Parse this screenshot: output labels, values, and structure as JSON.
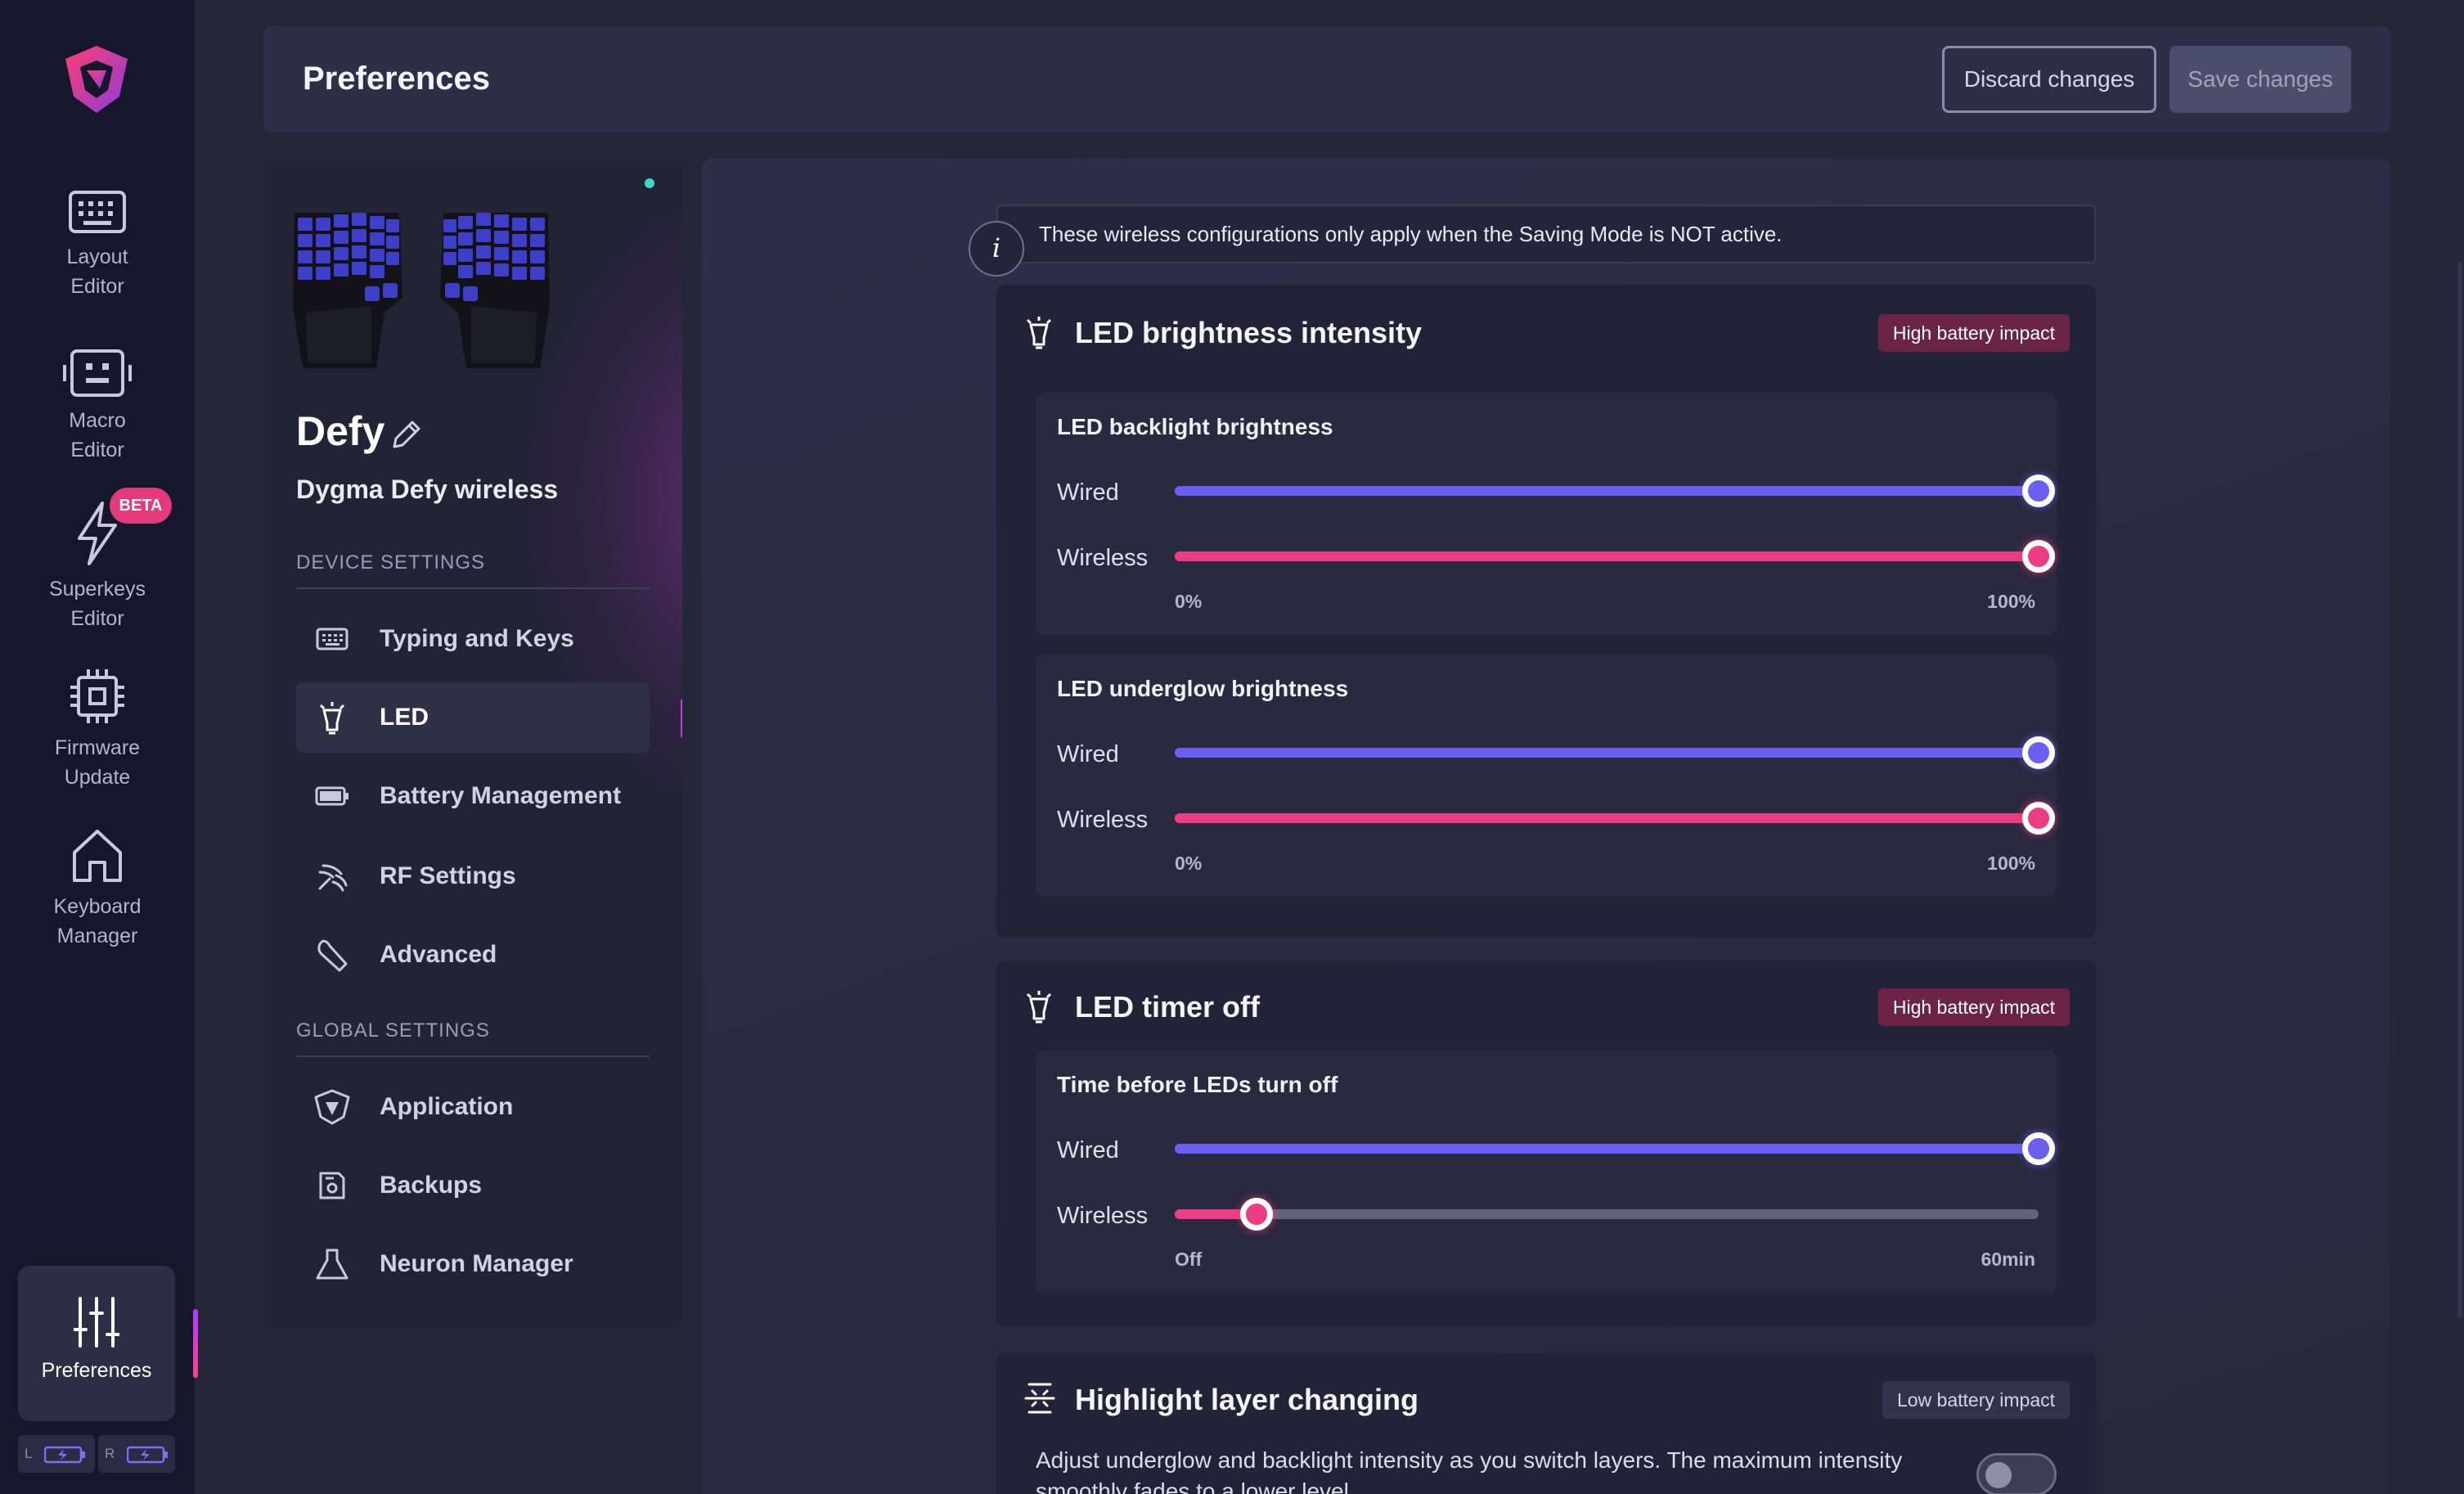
{
  "header": {
    "title": "Preferences",
    "discard_label": "Discard changes",
    "save_label": "Save changes"
  },
  "rail": {
    "items": [
      {
        "label_1": "Layout",
        "label_2": "Editor",
        "icon": "keyboard-icon"
      },
      {
        "label_1": "Macro",
        "label_2": "Editor",
        "icon": "macro-icon"
      },
      {
        "label_1": "Superkeys",
        "label_2": "Editor",
        "icon": "lightning-icon",
        "badge": "BETA"
      },
      {
        "label_1": "Firmware",
        "label_2": "Update",
        "icon": "chip-icon"
      },
      {
        "label_1": "Keyboard",
        "label_2": "Manager",
        "icon": "home-icon"
      }
    ],
    "preferences_label": "Preferences",
    "battery_left": "L",
    "battery_right": "R"
  },
  "device": {
    "name": "Defy",
    "model": "Dygma Defy wireless",
    "device_settings_label": "DEVICE SETTINGS",
    "global_settings_label": "GLOBAL SETTINGS",
    "device_menu": [
      {
        "label": "Typing and Keys",
        "icon": "keyboard-icon"
      },
      {
        "label": "LED",
        "icon": "bulb-icon"
      },
      {
        "label": "Battery Management",
        "icon": "battery-icon"
      },
      {
        "label": "RF Settings",
        "icon": "radio-icon"
      },
      {
        "label": "Advanced",
        "icon": "wrench-icon"
      }
    ],
    "global_menu": [
      {
        "label": "Application",
        "icon": "shield-logo-icon"
      },
      {
        "label": "Backups",
        "icon": "save-icon"
      },
      {
        "label": "Neuron Manager",
        "icon": "neuron-icon"
      }
    ],
    "active_item": "LED"
  },
  "notice": {
    "text": "These wireless configurations only apply when the Saving Mode is NOT active.",
    "icon_glyph": "i"
  },
  "cards": {
    "brightness": {
      "title": "LED brightness intensity",
      "badge": "High battery impact",
      "backlight": {
        "title": "LED backlight brightness",
        "wired_label": "Wired",
        "wireless_label": "Wireless",
        "wired_value": 100,
        "wireless_value": 100,
        "min_label": "0%",
        "max_label": "100%"
      },
      "underglow": {
        "title": "LED underglow brightness",
        "wired_label": "Wired",
        "wireless_label": "Wireless",
        "wired_value": 100,
        "wireless_value": 100,
        "min_label": "0%",
        "max_label": "100%"
      }
    },
    "timer": {
      "title": "LED timer off",
      "badge": "High battery impact",
      "sub_title": "Time before LEDs turn off",
      "wired_label": "Wired",
      "wireless_label": "Wireless",
      "wired_value": 100,
      "wireless_value": 9.5,
      "min_label": "Off",
      "max_label": "60min"
    },
    "highlight": {
      "title": "Highlight layer changing",
      "badge": "Low battery impact",
      "description": "Adjust underglow and backlight intensity as you switch layers. The maximum intensity smoothly fades to a lower level.",
      "enabled": false
    }
  },
  "colors": {
    "accent_blue": "#6a5ff0",
    "accent_pink": "#ec3d82",
    "badge_high": "#6b2448",
    "badge_low": "#33344b"
  }
}
